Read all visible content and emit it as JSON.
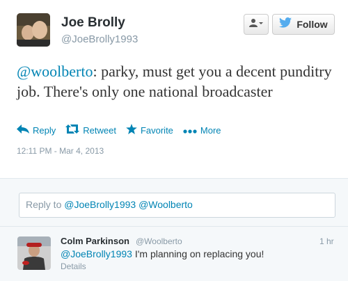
{
  "tweet": {
    "name": "Joe Brolly",
    "handle": "@JoeBrolly1993",
    "text_mention": "@woolberto",
    "text_body": ": parky, must get you a decent punditry job. There's only one national broadcaster",
    "timestamp": "12:11 PM - Mar 4, 2013",
    "avatar_icon": "profile-photo"
  },
  "header_buttons": {
    "follow_label": "Follow",
    "user_menu_icon": "person-dropdown-icon",
    "follow_icon": "twitter-bird-icon"
  },
  "actions": [
    {
      "label": "Reply",
      "icon": "reply-arrow-icon"
    },
    {
      "label": "Retweet",
      "icon": "retweet-icon"
    },
    {
      "label": "Favorite",
      "icon": "star-icon"
    },
    {
      "label": "More",
      "icon": "ellipsis-icon"
    }
  ],
  "reply_box": {
    "prefix": "Reply to ",
    "handle1": "@JoeBrolly1993",
    "handle2": "@Woolberto"
  },
  "reply_tweet": {
    "name": "Colm Parkinson",
    "handle": "@Woolberto",
    "time": "1 hr",
    "mention": "@JoeBrolly1993",
    "text": " I'm planning on replacing you!",
    "details": "Details"
  },
  "colors": {
    "link": "#0084b4",
    "muted": "#8899a6",
    "twitter_blue": "#55acee"
  }
}
